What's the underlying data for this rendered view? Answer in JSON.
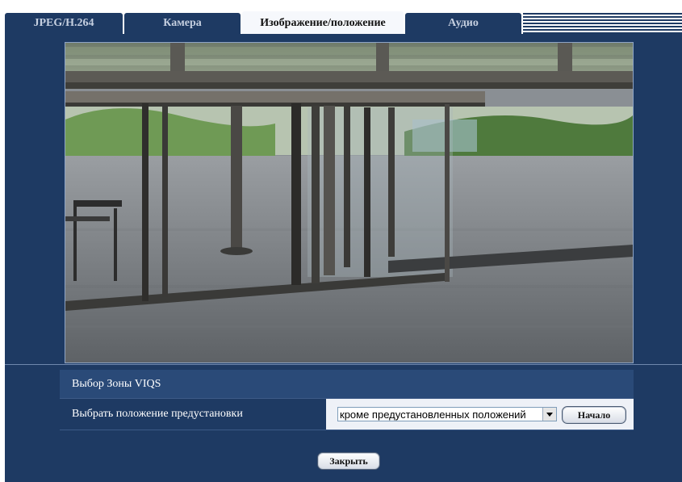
{
  "tabs": [
    {
      "label": "JPEG/H.264",
      "active": false
    },
    {
      "label": "Камера",
      "active": false
    },
    {
      "label": "Изображение/положение",
      "active": true
    },
    {
      "label": "Аудио",
      "active": false
    }
  ],
  "settings": {
    "viqs_zone_label": "Выбор Зоны VIQS",
    "preset_label": "Выбрать положение предустановки",
    "preset_select_value": "кроме предустановленных положений",
    "start_button": "Начало"
  },
  "close_button": "Закрыть",
  "colors": {
    "panel": "#1e3a63",
    "active_tab": "#f6f8fc"
  }
}
